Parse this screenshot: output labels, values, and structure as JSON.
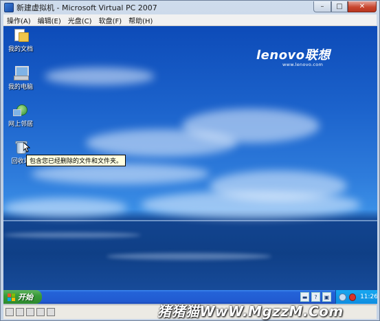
{
  "window": {
    "title": "新建虚拟机 - Microsoft Virtual PC 2007",
    "menu": [
      "操作(A)",
      "编辑(E)",
      "光盘(C)",
      "软盘(F)",
      "帮助(H)"
    ],
    "min_glyph": "–",
    "max_glyph": "□",
    "close_glyph": "✕"
  },
  "wallpaper": {
    "brand": "lenovo联想",
    "url": "www.lenovo.com"
  },
  "desktop_icons": [
    {
      "label": "我的文档",
      "icon": "my-documents-icon"
    },
    {
      "label": "我的电脑",
      "icon": "my-computer-icon"
    },
    {
      "label": "网上邻居",
      "icon": "network-places-icon"
    },
    {
      "label": "回收站",
      "icon": "recycle-bin-icon"
    }
  ],
  "tooltip": "包含您已经删除的文件和文件夹。",
  "taskbar": {
    "start_label": "开始",
    "clock": "11:26",
    "tray_glyphs": [
      "▬",
      "?",
      "▣"
    ]
  },
  "watermark": "猪猪猫WwW.MgzzM.Com",
  "colors": {
    "desktop_blue": "#1c63cc",
    "taskbar_blue": "#2463d8",
    "start_green": "#3a9b3a",
    "tooltip_bg": "#ffffe1"
  }
}
